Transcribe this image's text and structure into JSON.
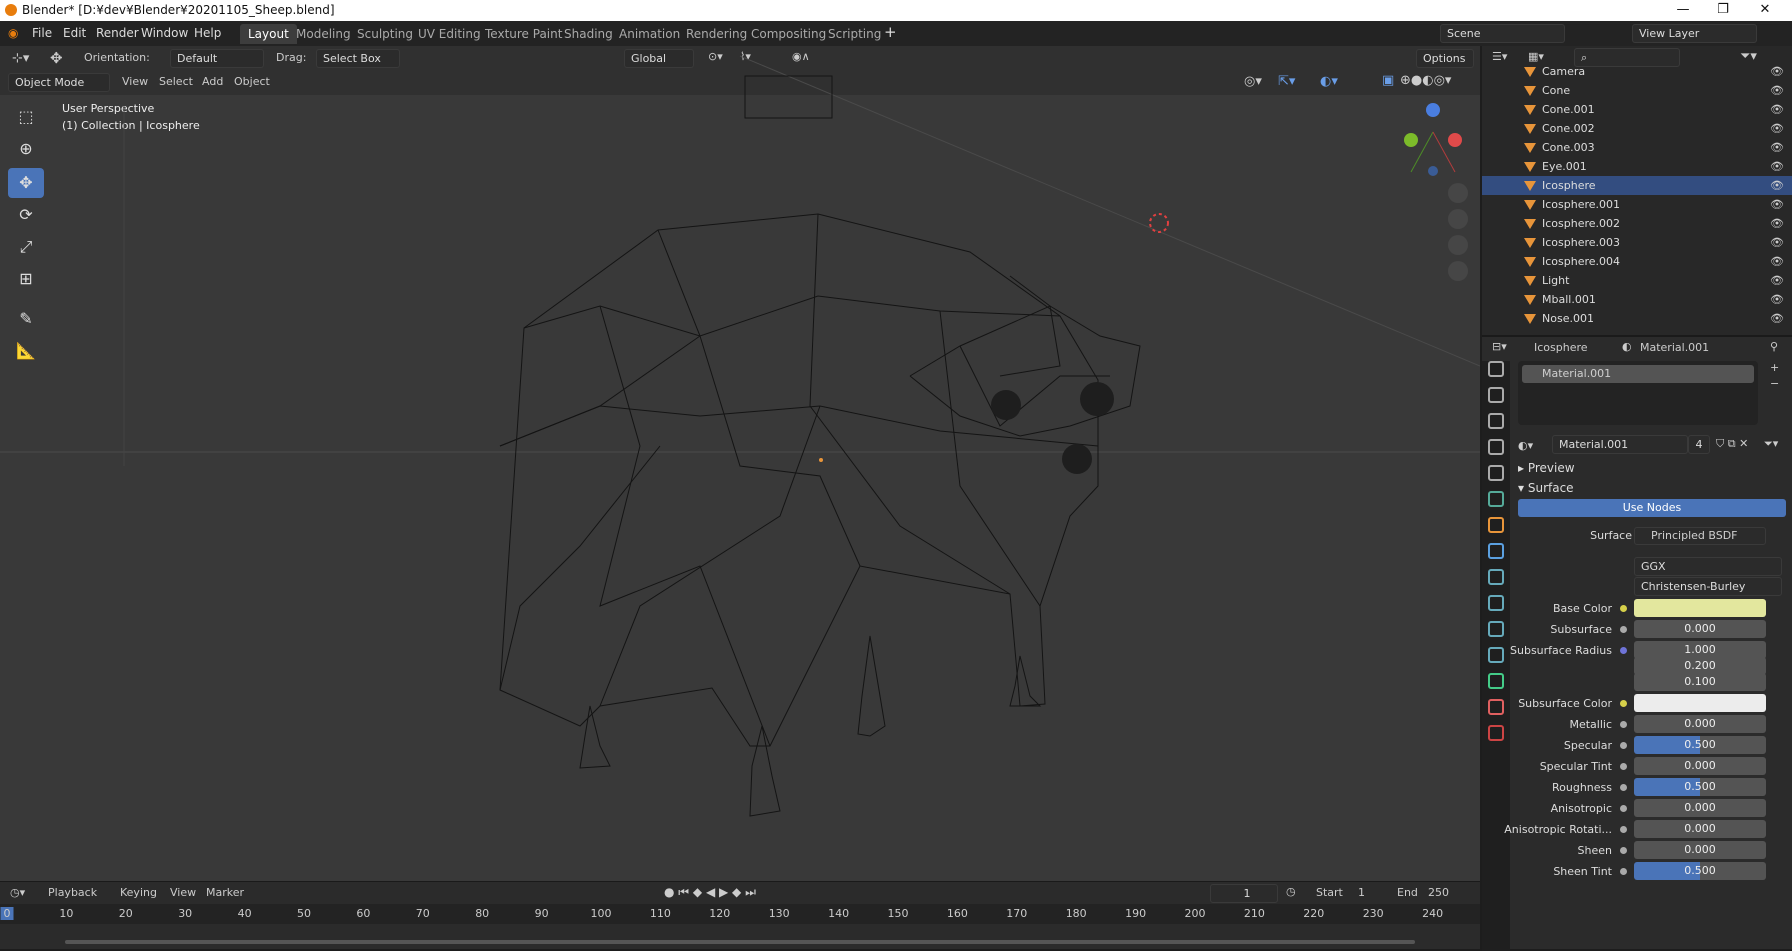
{
  "window": {
    "title": "Blender* [D:¥dev¥Blender¥20201105_Sheep.blend]"
  },
  "menu": [
    "File",
    "Edit",
    "Render",
    "Window",
    "Help"
  ],
  "workspaces": [
    "Layout",
    "Modeling",
    "Sculpting",
    "UV Editing",
    "Texture Paint",
    "Shading",
    "Animation",
    "Rendering",
    "Compositing",
    "Scripting"
  ],
  "scene": "Scene",
  "view_layer": "View Layer",
  "header": {
    "orientation_label": "Orientation:",
    "orientation_value": "Default",
    "drag_label": "Drag:",
    "drag_value": "Select Box",
    "transform": "Global",
    "options": "Options"
  },
  "vpmenu": {
    "mode": "Object Mode",
    "view": "View",
    "select": "Select",
    "add": "Add",
    "object": "Object"
  },
  "viewport": {
    "perspective": "User Perspective",
    "collection": "(1) Collection | Icosphere"
  },
  "outliner": [
    "Camera",
    "Cone",
    "Cone.001",
    "Cone.002",
    "Cone.003",
    "Eye.001",
    "Icosphere",
    "Icosphere.001",
    "Icosphere.002",
    "Icosphere.003",
    "Icosphere.004",
    "Light",
    "Mball.001",
    "Nose.001"
  ],
  "props": {
    "object": "Icosphere",
    "material": "Material.001",
    "slot": "Material.001",
    "users": "4",
    "preview": "Preview",
    "surface_panel": "Surface",
    "use_nodes": "Use Nodes",
    "surface_label": "Surface",
    "surface_value": "Principled BSDF",
    "distribution": "GGX",
    "subsurface_method": "Christensen-Burley",
    "fields": [
      {
        "label": "Base Color",
        "value": "",
        "color": "#e3e79e"
      },
      {
        "label": "Subsurface",
        "value": "0.000"
      },
      {
        "label": "Subsurface Radius",
        "value": "1.000"
      },
      {
        "label": "",
        "value": "0.200"
      },
      {
        "label": "",
        "value": "0.100"
      },
      {
        "label": "Subsurface Color",
        "value": "",
        "color": "#ececec"
      },
      {
        "label": "Metallic",
        "value": "0.000"
      },
      {
        "label": "Specular",
        "value": "0.500",
        "fill": 0.5
      },
      {
        "label": "Specular Tint",
        "value": "0.000"
      },
      {
        "label": "Roughness",
        "value": "0.500",
        "fill": 0.5
      },
      {
        "label": "Anisotropic",
        "value": "0.000"
      },
      {
        "label": "Anisotropic Rotati...",
        "value": "0.000"
      },
      {
        "label": "Sheen",
        "value": "0.000"
      },
      {
        "label": "Sheen Tint",
        "value": "0.500",
        "fill": 0.5
      }
    ]
  },
  "timeline": {
    "playback": "Playback",
    "keying": "Keying",
    "view": "View",
    "marker": "Marker",
    "frame": "1",
    "start_label": "Start",
    "start": "1",
    "end_label": "End",
    "end": "250",
    "ticks": [
      "0",
      "10",
      "20",
      "30",
      "40",
      "50",
      "60",
      "70",
      "80",
      "90",
      "100",
      "110",
      "120",
      "130",
      "140",
      "150",
      "160",
      "170",
      "180",
      "190",
      "200",
      "210",
      "220",
      "230",
      "240"
    ]
  }
}
